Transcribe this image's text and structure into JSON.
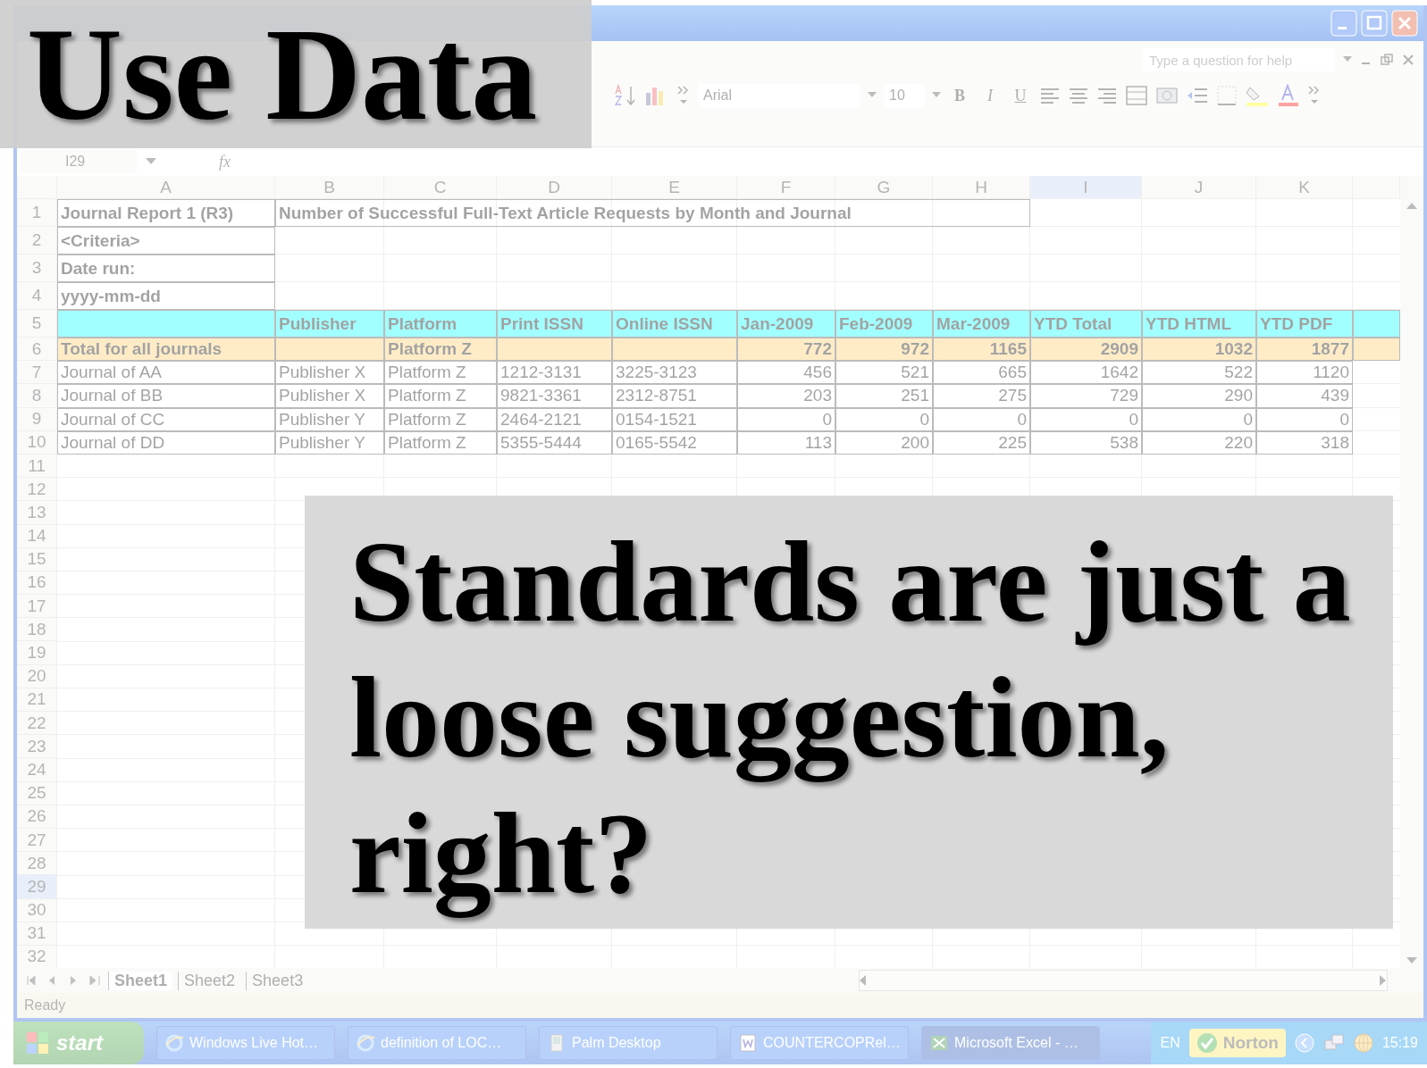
{
  "slide_title": "Use Data",
  "callout": "Standards are just a loose suggestion, right?",
  "help_box": {
    "placeholder": "Type a question for help"
  },
  "formatting": {
    "font": "Arial",
    "size": "10",
    "style_buttons": [
      {
        "kind": "bold",
        "label": "B"
      },
      {
        "kind": "italic",
        "label": "I"
      },
      {
        "kind": "underline",
        "label": "U"
      }
    ]
  },
  "formula_bar": {
    "name_box": "I29",
    "function_label": "fx"
  },
  "sheet": {
    "columns": [
      {
        "label": "A",
        "selected": false
      },
      {
        "label": "B",
        "selected": false
      },
      {
        "label": "C",
        "selected": false
      },
      {
        "label": "D",
        "selected": false
      },
      {
        "label": "E",
        "selected": false
      },
      {
        "label": "F",
        "selected": false
      },
      {
        "label": "G",
        "selected": false
      },
      {
        "label": "H",
        "selected": false
      },
      {
        "label": "I",
        "selected": true
      },
      {
        "label": "J",
        "selected": false
      },
      {
        "label": "K",
        "selected": false
      }
    ],
    "rows": [
      {
        "label": "1",
        "selected": false
      },
      {
        "label": "2",
        "selected": false
      },
      {
        "label": "3",
        "selected": false
      },
      {
        "label": "4",
        "selected": false
      },
      {
        "label": "5",
        "selected": false
      },
      {
        "label": "6",
        "selected": false
      },
      {
        "label": "7",
        "selected": false
      },
      {
        "label": "8",
        "selected": false
      },
      {
        "label": "9",
        "selected": false
      },
      {
        "label": "10",
        "selected": false
      },
      {
        "label": "11",
        "selected": false
      },
      {
        "label": "12",
        "selected": false
      },
      {
        "label": "13",
        "selected": false
      },
      {
        "label": "14",
        "selected": false
      },
      {
        "label": "15",
        "selected": false
      },
      {
        "label": "16",
        "selected": false
      },
      {
        "label": "17",
        "selected": false
      },
      {
        "label": "18",
        "selected": false
      },
      {
        "label": "19",
        "selected": false
      },
      {
        "label": "20",
        "selected": false
      },
      {
        "label": "21",
        "selected": false
      },
      {
        "label": "22",
        "selected": false
      },
      {
        "label": "23",
        "selected": false
      },
      {
        "label": "24",
        "selected": false
      },
      {
        "label": "25",
        "selected": false
      },
      {
        "label": "26",
        "selected": false
      },
      {
        "label": "27",
        "selected": false
      },
      {
        "label": "28",
        "selected": false
      },
      {
        "label": "29",
        "selected": true
      },
      {
        "label": "30",
        "selected": false
      },
      {
        "label": "31",
        "selected": false
      },
      {
        "label": "32",
        "selected": false
      }
    ],
    "cell_rows": [
      {
        "kind": "title",
        "cells": [
          "Journal Report 1 (R3)",
          "Number of Successful Full-Text Article Requests by Month and Journal"
        ]
      },
      {
        "kind": "label",
        "cells": [
          "<Criteria>"
        ]
      },
      {
        "kind": "label",
        "cells": [
          "Date run:"
        ]
      },
      {
        "kind": "label",
        "cells": [
          "yyyy-mm-dd"
        ]
      },
      {
        "kind": "header",
        "cells": [
          null,
          "Publisher",
          "Platform",
          "Print ISSN",
          "Online ISSN",
          "Jan-2009",
          "Feb-2009",
          "Mar-2009",
          "YTD Total",
          "YTD HTML",
          "YTD PDF"
        ]
      },
      {
        "kind": "total",
        "cells": [
          "Total for all journals",
          null,
          "Platform Z",
          null,
          null,
          "772",
          "972",
          "1165",
          "2909",
          "1032",
          "1877"
        ]
      },
      {
        "kind": "data",
        "cells": [
          "Journal of AA",
          "Publisher X",
          "Platform Z",
          "1212-3131",
          "3225-3123",
          "456",
          "521",
          "665",
          "1642",
          "522",
          "1120"
        ]
      },
      {
        "kind": "data",
        "cells": [
          "Journal of BB",
          "Publisher X",
          "Platform Z",
          "9821-3361",
          "2312-8751",
          "203",
          "251",
          "275",
          "729",
          "290",
          "439"
        ]
      },
      {
        "kind": "data",
        "cells": [
          "Journal of CC",
          "Publisher Y",
          "Platform Z",
          "2464-2121",
          "0154-1521",
          "0",
          "0",
          "0",
          "0",
          "0",
          "0"
        ]
      },
      {
        "kind": "data",
        "cells": [
          "Journal of DD",
          "Publisher Y",
          "Platform Z",
          "5355-5444",
          "0165-5542",
          "113",
          "200",
          "225",
          "538",
          "220",
          "318"
        ]
      }
    ]
  },
  "sheet_tabs": [
    {
      "label": "Sheet1",
      "selected": true
    },
    {
      "label": "Sheet2",
      "selected": false
    },
    {
      "label": "Sheet3",
      "selected": false
    }
  ],
  "status_bar": "Ready",
  "taskbar": {
    "start": "start",
    "tasks": [
      {
        "kind": "browser",
        "label": "Windows Live Hot…",
        "selected": false
      },
      {
        "kind": "browser",
        "label": "definition of LOC…",
        "selected": false
      },
      {
        "kind": "palm",
        "label": "Palm Desktop",
        "selected": false
      },
      {
        "kind": "document",
        "label": "COUNTERCOPRel…",
        "selected": false
      },
      {
        "kind": "spreadsheet",
        "label": "Microsoft Excel - …",
        "selected": true
      }
    ],
    "language": "EN",
    "antivirus": "Norton",
    "clock": "15:19"
  }
}
